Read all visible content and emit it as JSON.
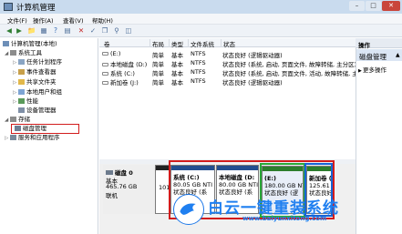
{
  "window": {
    "title": "计算机管理"
  },
  "menu": {
    "items": [
      "文件(F)",
      "操作(A)",
      "查看(V)",
      "帮助(H)"
    ]
  },
  "tree": {
    "root": "计算机管理(本地)",
    "system_tools": "系统工具",
    "task_scheduler": "任务计划程序",
    "event_viewer": "事件查看器",
    "shared_folders": "共享文件夹",
    "local_users": "本地用户和组",
    "performance": "性能",
    "device_manager": "设备管理器",
    "storage": "存储",
    "disk_management": "磁盘管理",
    "services": "服务和应用程序"
  },
  "volumes": {
    "headers": [
      "卷",
      "布局",
      "类型",
      "文件系统",
      "状态"
    ],
    "rows": [
      {
        "vol": "(E:)",
        "layout": "简单",
        "type": "基本",
        "fs": "NTFS",
        "status": "状态良好 (逻辑驱动器)"
      },
      {
        "vol": "本地磁盘 (D:)",
        "layout": "简单",
        "type": "基本",
        "fs": "NTFS",
        "status": "状态良好 (系统, 启动, 页面文件, 故障转储, 主分区)"
      },
      {
        "vol": "系统 (C:)",
        "layout": "简单",
        "type": "基本",
        "fs": "NTFS",
        "status": "状态良好 (系统, 启动, 页面文件, 活动, 故障转储, 主分区)"
      },
      {
        "vol": "新加卷 (J:)",
        "layout": "简单",
        "type": "基本",
        "fs": "NTFS",
        "status": "状态良好 (逻辑驱动器)"
      }
    ]
  },
  "disk": {
    "name": "磁盘 0",
    "type": "基本",
    "size": "465.76 GB",
    "status": "联机",
    "unalloc": "101"
  },
  "partitions": [
    {
      "name": "系统 (C:)",
      "size": "80.05 GB NTI",
      "status": "状态良好 (系"
    },
    {
      "name": "本地磁盘 (D:",
      "size": "80.00 GB NTI",
      "status": "状态良好 (系"
    },
    {
      "name": "(E:)",
      "size": "180.00 GB NT",
      "status": "状态良好 (逻"
    },
    {
      "name": "新加卷 (J:)",
      "size": "125.61 GB NT",
      "status": "状态良好 (逻"
    }
  ],
  "actions": {
    "title": "操作",
    "section": "磁盘管理",
    "more": "更多操作"
  },
  "watermark": {
    "text": "白云一键重装系统",
    "url": "www.baiyunxitong.com"
  },
  "colors": {
    "primary_partition": "#234e8f",
    "logical_partition": "#2c7d2c",
    "annotation_red": "#d21c1c",
    "annotation_green": "#29a838",
    "annotation_blue": "#1664d6",
    "watermark": "#1f7ff0"
  }
}
